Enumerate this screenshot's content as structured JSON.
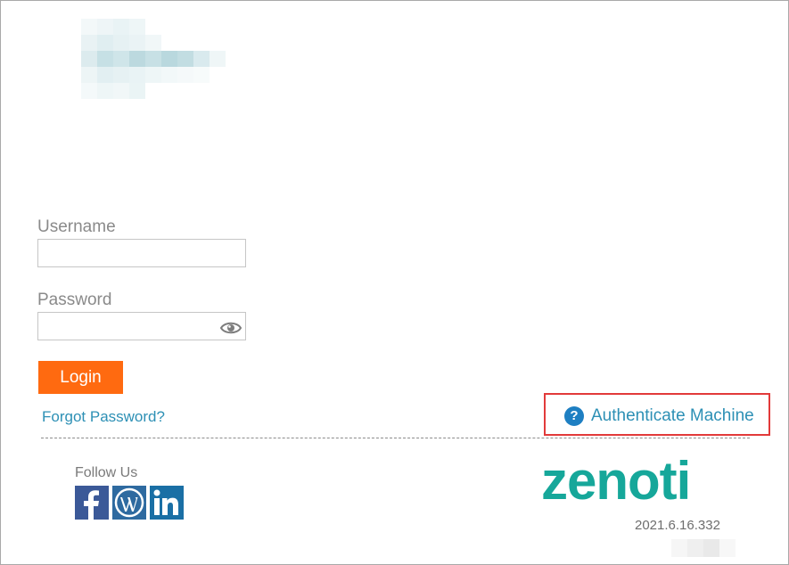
{
  "form": {
    "username_label": "Username",
    "username_value": "",
    "password_label": "Password",
    "password_value": "",
    "show_password_icon": "eye-icon"
  },
  "actions": {
    "login_label": "Login",
    "forgot_password_label": "Forgot Password?",
    "authenticate_machine_label": "Authenticate Machine",
    "authenticate_icon": "help-circle-icon",
    "highlight_color": "#e23a3a"
  },
  "footer": {
    "follow_us_label": "Follow Us",
    "social": [
      {
        "name": "Facebook",
        "icon": "facebook-icon",
        "color": "#3b5998"
      },
      {
        "name": "WordPress",
        "icon": "wordpress-icon",
        "color": "#2e6aa0"
      },
      {
        "name": "LinkedIn",
        "icon": "linkedin-icon",
        "color": "#1a6fa5"
      }
    ],
    "brand_text": "zenoti",
    "version": "2021.6.16.332"
  },
  "colors": {
    "accent": "#ff6a10",
    "link": "#2d90b5",
    "brand": "#16a79a"
  }
}
